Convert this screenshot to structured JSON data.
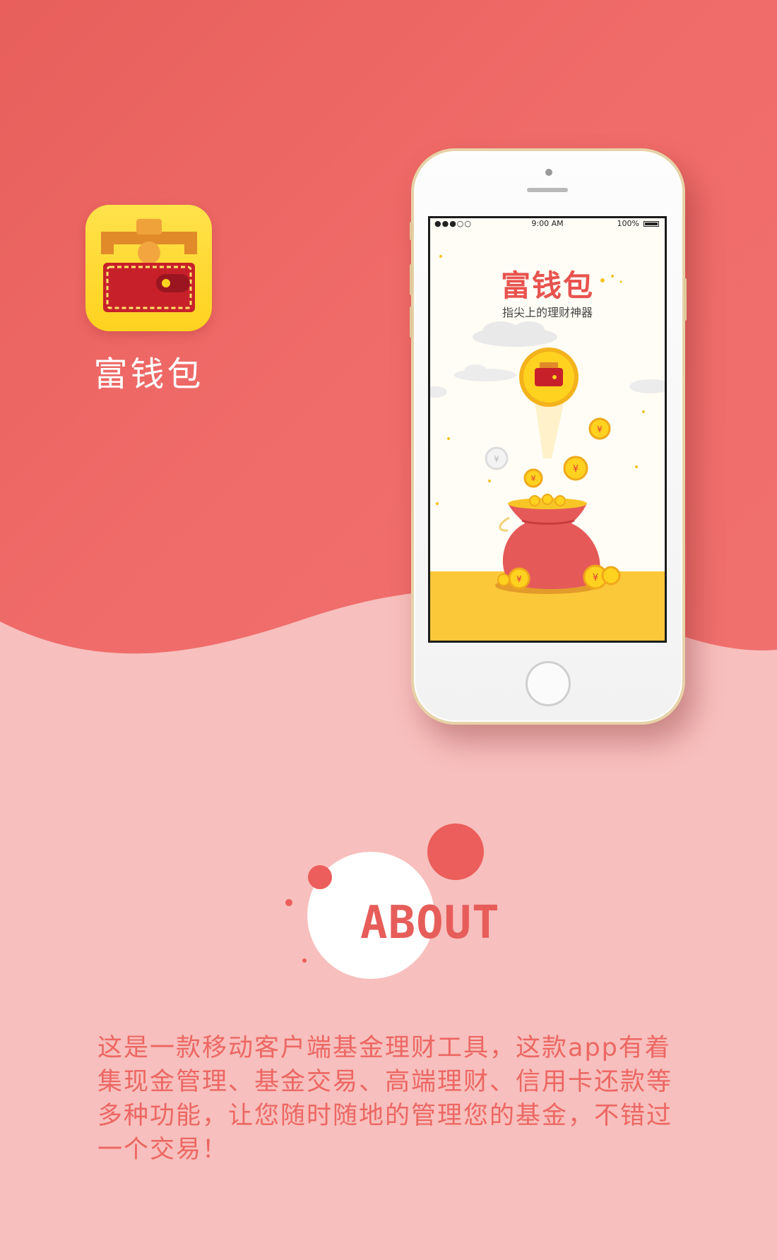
{
  "app": {
    "name": "富钱包"
  },
  "phone": {
    "status": {
      "signal": "●●●○○",
      "time": "9:00 AM",
      "battery": "100%"
    },
    "screen": {
      "title": "富钱包",
      "subtitle": "指尖上的理财神器"
    }
  },
  "about": {
    "title": "ABOUT",
    "body": "这是一款移动客户端基金理财工具，这款app有着集现金管理、基金交易、高端理财、信用卡还款等多种功能，让您随时随地的管理您的基金，不错过一个交易！"
  },
  "colors": {
    "primary": "#ee6a67",
    "background_light": "#f7bfbd",
    "accent_yellow": "#ffd21f",
    "text_red": "#ec6763"
  },
  "icons": [
    "wallet-icon",
    "coin-icon",
    "money-bag-icon",
    "cloud-icon"
  ]
}
